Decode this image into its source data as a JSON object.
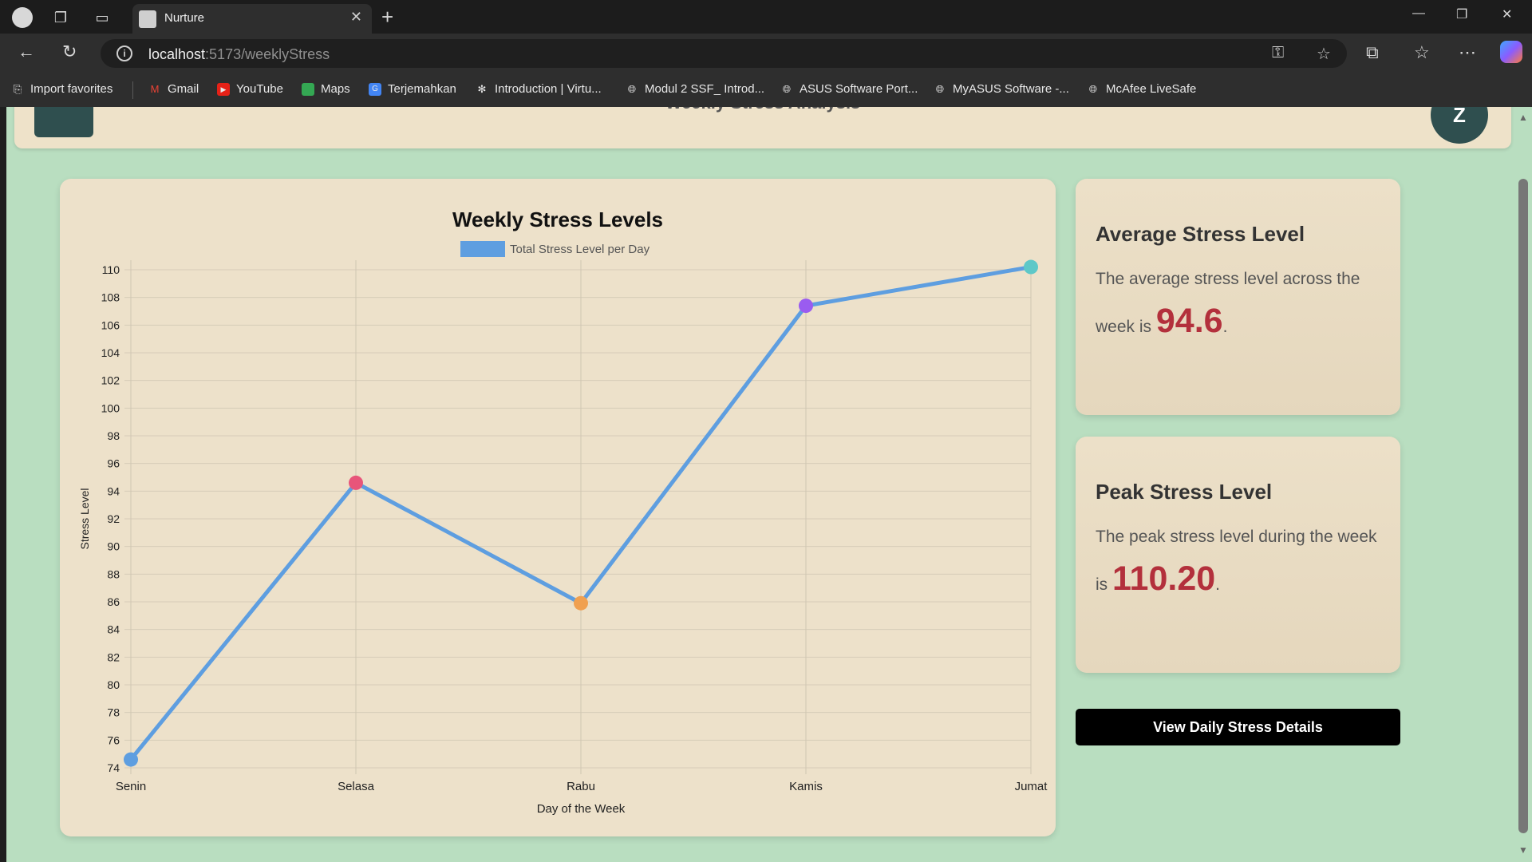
{
  "browser": {
    "tab_title": "Nurture",
    "url_host": "localhost",
    "url_path": ":5173/weeklyStress",
    "bookmarks": [
      "Import favorites",
      "Gmail",
      "YouTube",
      "Maps",
      "Terjemahkan",
      "Introduction | Virtu...",
      "Modul 2 SSF_ Introd...",
      "ASUS Software Port...",
      "MyASUS Software -...",
      "McAfee LiveSafe"
    ]
  },
  "header": {
    "title": "Weekly Stress Analysis"
  },
  "chart_data": {
    "type": "line",
    "title": "Weekly Stress Levels",
    "legend": "Total Stress Level per Day",
    "xlabel": "Day of the Week",
    "ylabel": "Stress Level",
    "categories": [
      "Senin",
      "Selasa",
      "Rabu",
      "Kamis",
      "Jumat"
    ],
    "values": [
      74.6,
      94.6,
      85.9,
      107.4,
      110.2
    ],
    "point_colors": [
      "#5e9ee0",
      "#e8557a",
      "#f0a050",
      "#9a5cf0",
      "#5ec8c8"
    ],
    "line_color": "#5e9ee0",
    "ylim": [
      74,
      110
    ],
    "yticks": [
      74,
      76,
      78,
      80,
      82,
      84,
      86,
      88,
      90,
      92,
      94,
      96,
      98,
      100,
      102,
      104,
      106,
      108,
      110
    ],
    "grid": true,
    "legend_position": "top"
  },
  "average": {
    "title": "Average Stress Level",
    "text": "The average stress level across the week is",
    "value": "94.6"
  },
  "peak": {
    "title": "Peak Stress Level",
    "text": "The peak stress level during the week is",
    "value": "110.20"
  },
  "button": {
    "label": "View Daily Stress Details"
  }
}
